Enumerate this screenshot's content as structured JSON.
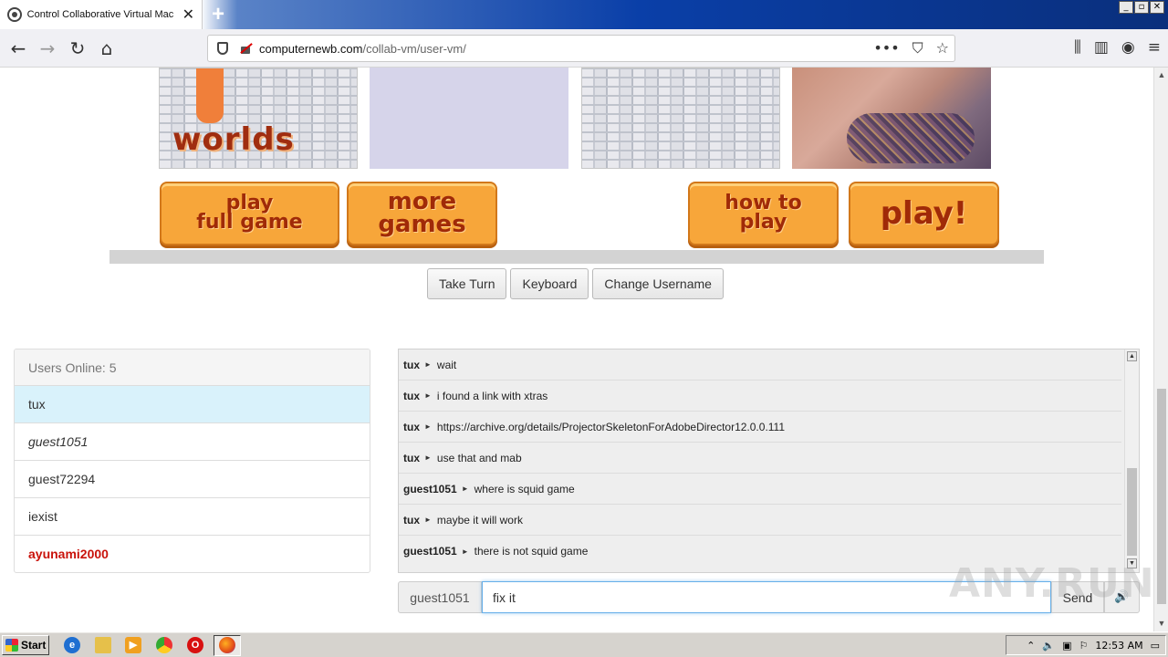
{
  "browser": {
    "tab_title": "Control Collaborative Virtual Machine",
    "tab_close": "✕",
    "new_tab": "+",
    "window_buttons": [
      "_",
      "▫",
      "✕"
    ],
    "url_host": "computernewb.com",
    "url_path": "/collab-vm/user-vm/",
    "url_more": "•••",
    "nav": {
      "back": "←",
      "forward": "→",
      "reload": "↻",
      "home": "⌂"
    }
  },
  "vm": {
    "worlds_text": "worlds",
    "buttons": [
      {
        "lines": [
          "play",
          "full game"
        ]
      },
      {
        "lines": [
          "more",
          "games"
        ]
      },
      {
        "lines": [
          "how to",
          "play"
        ]
      },
      {
        "lines": [
          "play!"
        ]
      }
    ]
  },
  "controls": {
    "take_turn": "Take Turn",
    "keyboard": "Keyboard",
    "change_username": "Change Username"
  },
  "users": {
    "header": "Users Online: 5",
    "list": [
      "tux",
      "guest1051",
      "guest72294",
      "iexist",
      "ayunami2000"
    ]
  },
  "chat": {
    "messages": [
      {
        "user": "tux",
        "text": "wait"
      },
      {
        "user": "tux",
        "text": "i found a link with xtras"
      },
      {
        "user": "tux",
        "text": "https://archive.org/details/ProjectorSkeletonForAdobeDirector12.0.0.111"
      },
      {
        "user": "tux",
        "text": "use that and mab"
      },
      {
        "user": "guest1051",
        "text": "where is squid game"
      },
      {
        "user": "tux",
        "text": "maybe it will work"
      },
      {
        "user": "guest1051",
        "text": "there is not squid game"
      }
    ],
    "input_username": "guest1051",
    "input_value": "fix it",
    "send_label": "Send",
    "volume_icon": "🔊"
  },
  "taskbar": {
    "start_label": "Start",
    "clock": "12:53 AM"
  },
  "watermark": "ANY.RUN",
  "colors": {
    "active_user_bg": "#d9f2fb",
    "admin_user": "#c9120a",
    "focus_border": "#66afe9"
  }
}
